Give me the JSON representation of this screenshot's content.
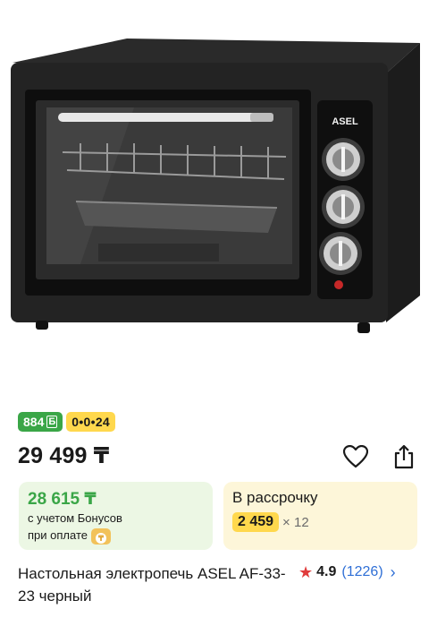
{
  "product": {
    "image_alt": "",
    "brand_text_on_device": "ASEL",
    "title": "Настольная электропечь ASEL AF-33-23 черный",
    "rating": "4.9",
    "reviews": "(1226)"
  },
  "badges": {
    "bonus": "884",
    "bonus_icon": "Б",
    "installment": "0•0•24"
  },
  "price": {
    "main": "29 499 ₸"
  },
  "bonus_card": {
    "price": "28 615 ₸",
    "line1": "с учетом Бонусов",
    "line2": "при оплате"
  },
  "installment_card": {
    "title": "В рассрочку",
    "amount": "2 459",
    "multiplier": "× 12"
  },
  "icons": {
    "favorite": "heart-icon",
    "share": "share-icon",
    "star": "star-icon",
    "chevron": "chevron-right-icon",
    "coin": "coin-icon"
  },
  "colors": {
    "green": "#3aa647",
    "yellow": "#ffd84d",
    "link_blue": "#2f6fd6",
    "star_red": "#e03c3c"
  }
}
